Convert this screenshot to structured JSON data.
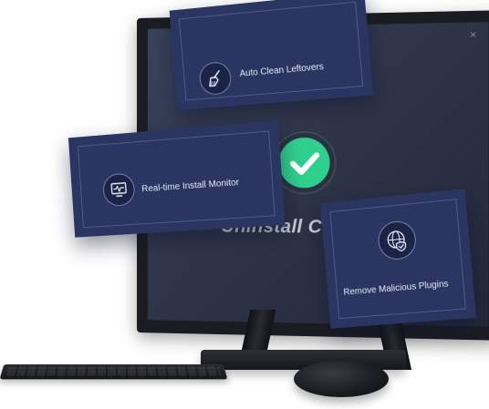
{
  "screen": {
    "close_glyph": "×",
    "status_text": "Uninstall Complet",
    "check_color": "#2fd08f"
  },
  "features": {
    "auto_clean": {
      "label": "Auto Clean Leftovers",
      "icon": "broom-icon"
    },
    "install_monitor": {
      "label": "Real-time Install Monitor",
      "icon": "monitor-pulse-icon"
    },
    "malicious_plugins": {
      "label": "Remove Malicious Plugins",
      "icon": "globe-shield-icon"
    }
  },
  "colors": {
    "card_bg": "#2a3561",
    "screen_bg": "#2f3547",
    "accent_green": "#2fd08f"
  }
}
